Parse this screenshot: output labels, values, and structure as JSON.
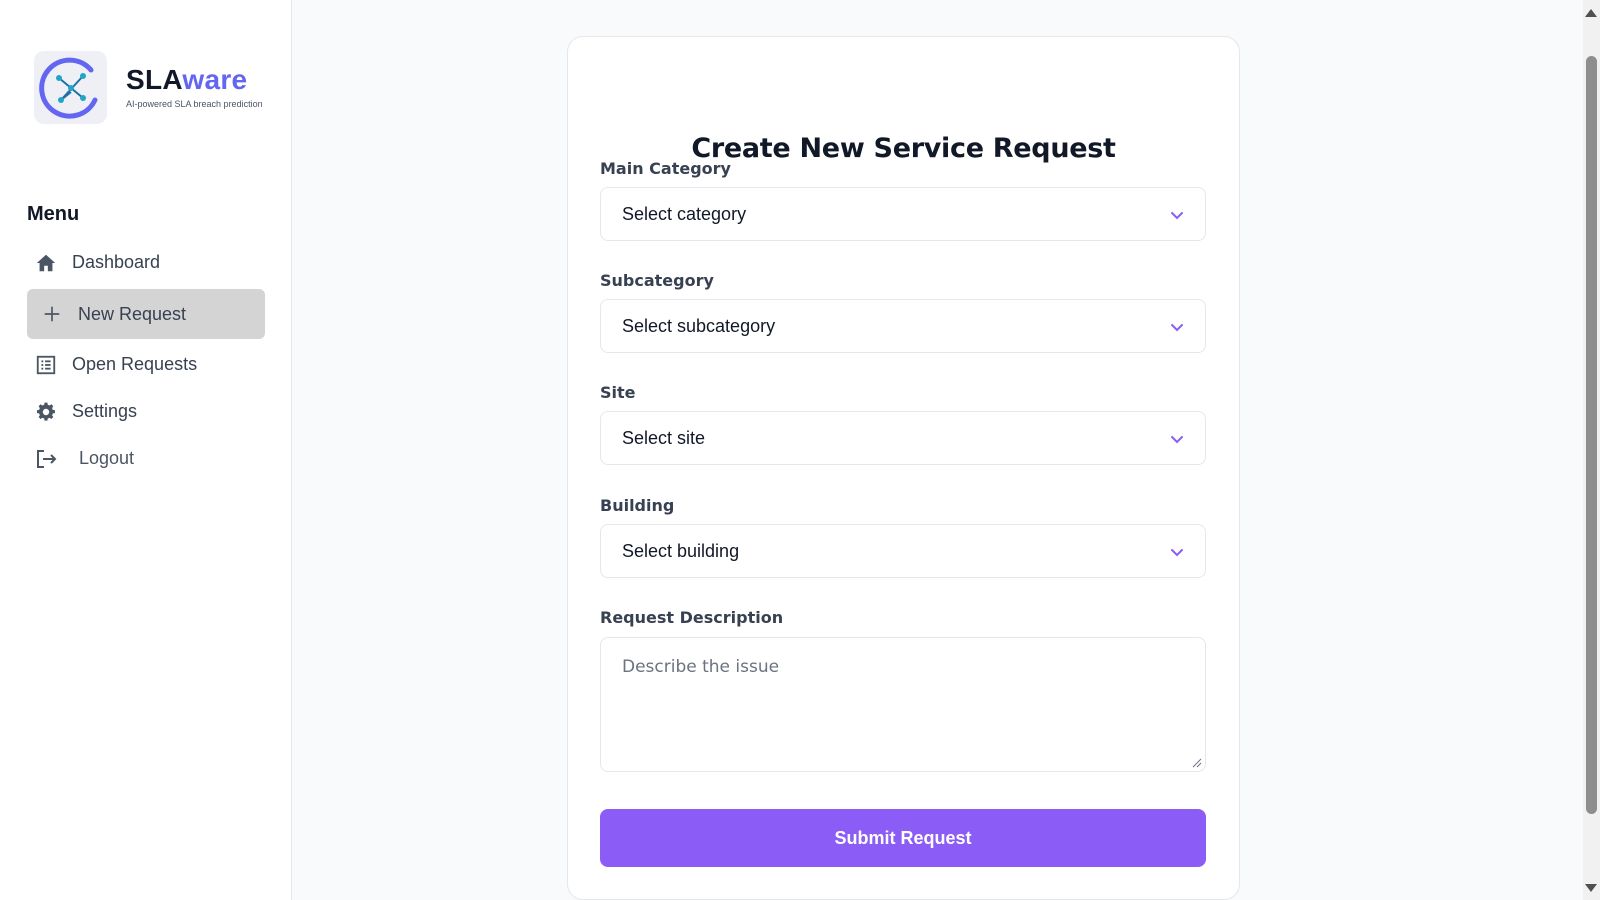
{
  "brand": {
    "name_part1": "SLA",
    "name_part2": "ware",
    "tagline": "AI-powered SLA breach prediction",
    "accent_color": "#6366f1"
  },
  "sidebar": {
    "menu_title": "Menu",
    "items": [
      {
        "label": "Dashboard",
        "icon": "home-icon",
        "active": false
      },
      {
        "label": "New Request",
        "icon": "plus-icon",
        "active": true
      },
      {
        "label": "Open Requests",
        "icon": "list-icon",
        "active": false
      },
      {
        "label": "Settings",
        "icon": "gear-icon",
        "active": false
      },
      {
        "label": "Logout",
        "icon": "logout-icon",
        "active": false
      }
    ]
  },
  "form": {
    "title": "Create New Service Request",
    "fields": [
      {
        "label": "Main Category",
        "placeholder": "Select category"
      },
      {
        "label": "Subcategory",
        "placeholder": "Select subcategory"
      },
      {
        "label": "Site",
        "placeholder": "Select site"
      },
      {
        "label": "Building",
        "placeholder": "Select building"
      }
    ],
    "description": {
      "label": "Request Description",
      "placeholder": "Describe the issue"
    },
    "submit_label": "Submit Request",
    "submit_color": "#8b5cf6"
  }
}
